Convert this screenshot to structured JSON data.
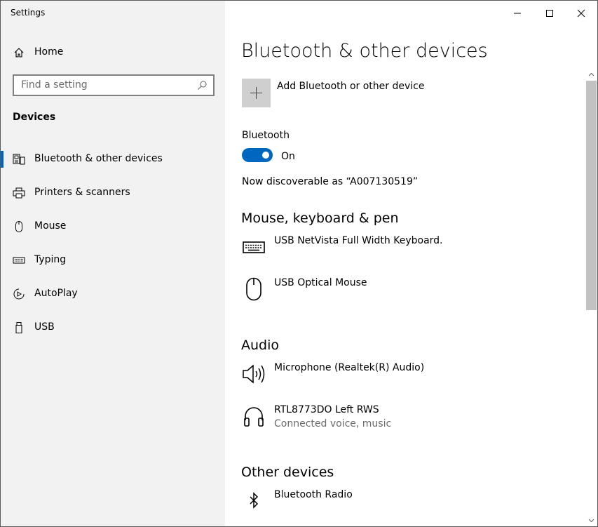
{
  "window": {
    "title": "Settings"
  },
  "sidebar": {
    "home_label": "Home",
    "search_placeholder": "Find a setting",
    "section_label": "Devices",
    "items": [
      {
        "label": "Bluetooth & other devices",
        "icon": "bluetooth-devices-icon",
        "selected": true
      },
      {
        "label": "Printers & scanners",
        "icon": "printer-icon",
        "selected": false
      },
      {
        "label": "Mouse",
        "icon": "mouse-icon",
        "selected": false
      },
      {
        "label": "Typing",
        "icon": "keyboard-icon",
        "selected": false
      },
      {
        "label": "AutoPlay",
        "icon": "autoplay-icon",
        "selected": false
      },
      {
        "label": "USB",
        "icon": "usb-icon",
        "selected": false
      }
    ]
  },
  "main": {
    "title": "Bluetooth & other devices",
    "add_label": "Add Bluetooth or other device",
    "bluetooth_label": "Bluetooth",
    "bluetooth_state": "On",
    "discoverable_text": "Now discoverable as “A007130519”",
    "groups": {
      "mouse_keyboard": {
        "heading": "Mouse, keyboard & pen",
        "devices": [
          {
            "name": "USB NetVista Full Width Keyboard.",
            "icon": "keyboard-icon"
          },
          {
            "name": "USB Optical Mouse",
            "icon": "mouse-icon"
          }
        ]
      },
      "audio": {
        "heading": "Audio",
        "devices": [
          {
            "name": "Microphone (Realtek(R) Audio)",
            "icon": "speaker-icon"
          },
          {
            "name": "RTL8773DO Left RWS",
            "status": "Connected voice, music",
            "icon": "headphones-icon"
          }
        ]
      },
      "other": {
        "heading": "Other devices",
        "devices": [
          {
            "name": "Bluetooth Radio",
            "icon": "bluetooth-icon"
          }
        ]
      }
    }
  },
  "colors": {
    "accent": "#0067c0",
    "sidebar_bg": "#f2f2f2",
    "tile_bg": "#cfcfcf",
    "secondary_text": "#6b6b6b"
  }
}
